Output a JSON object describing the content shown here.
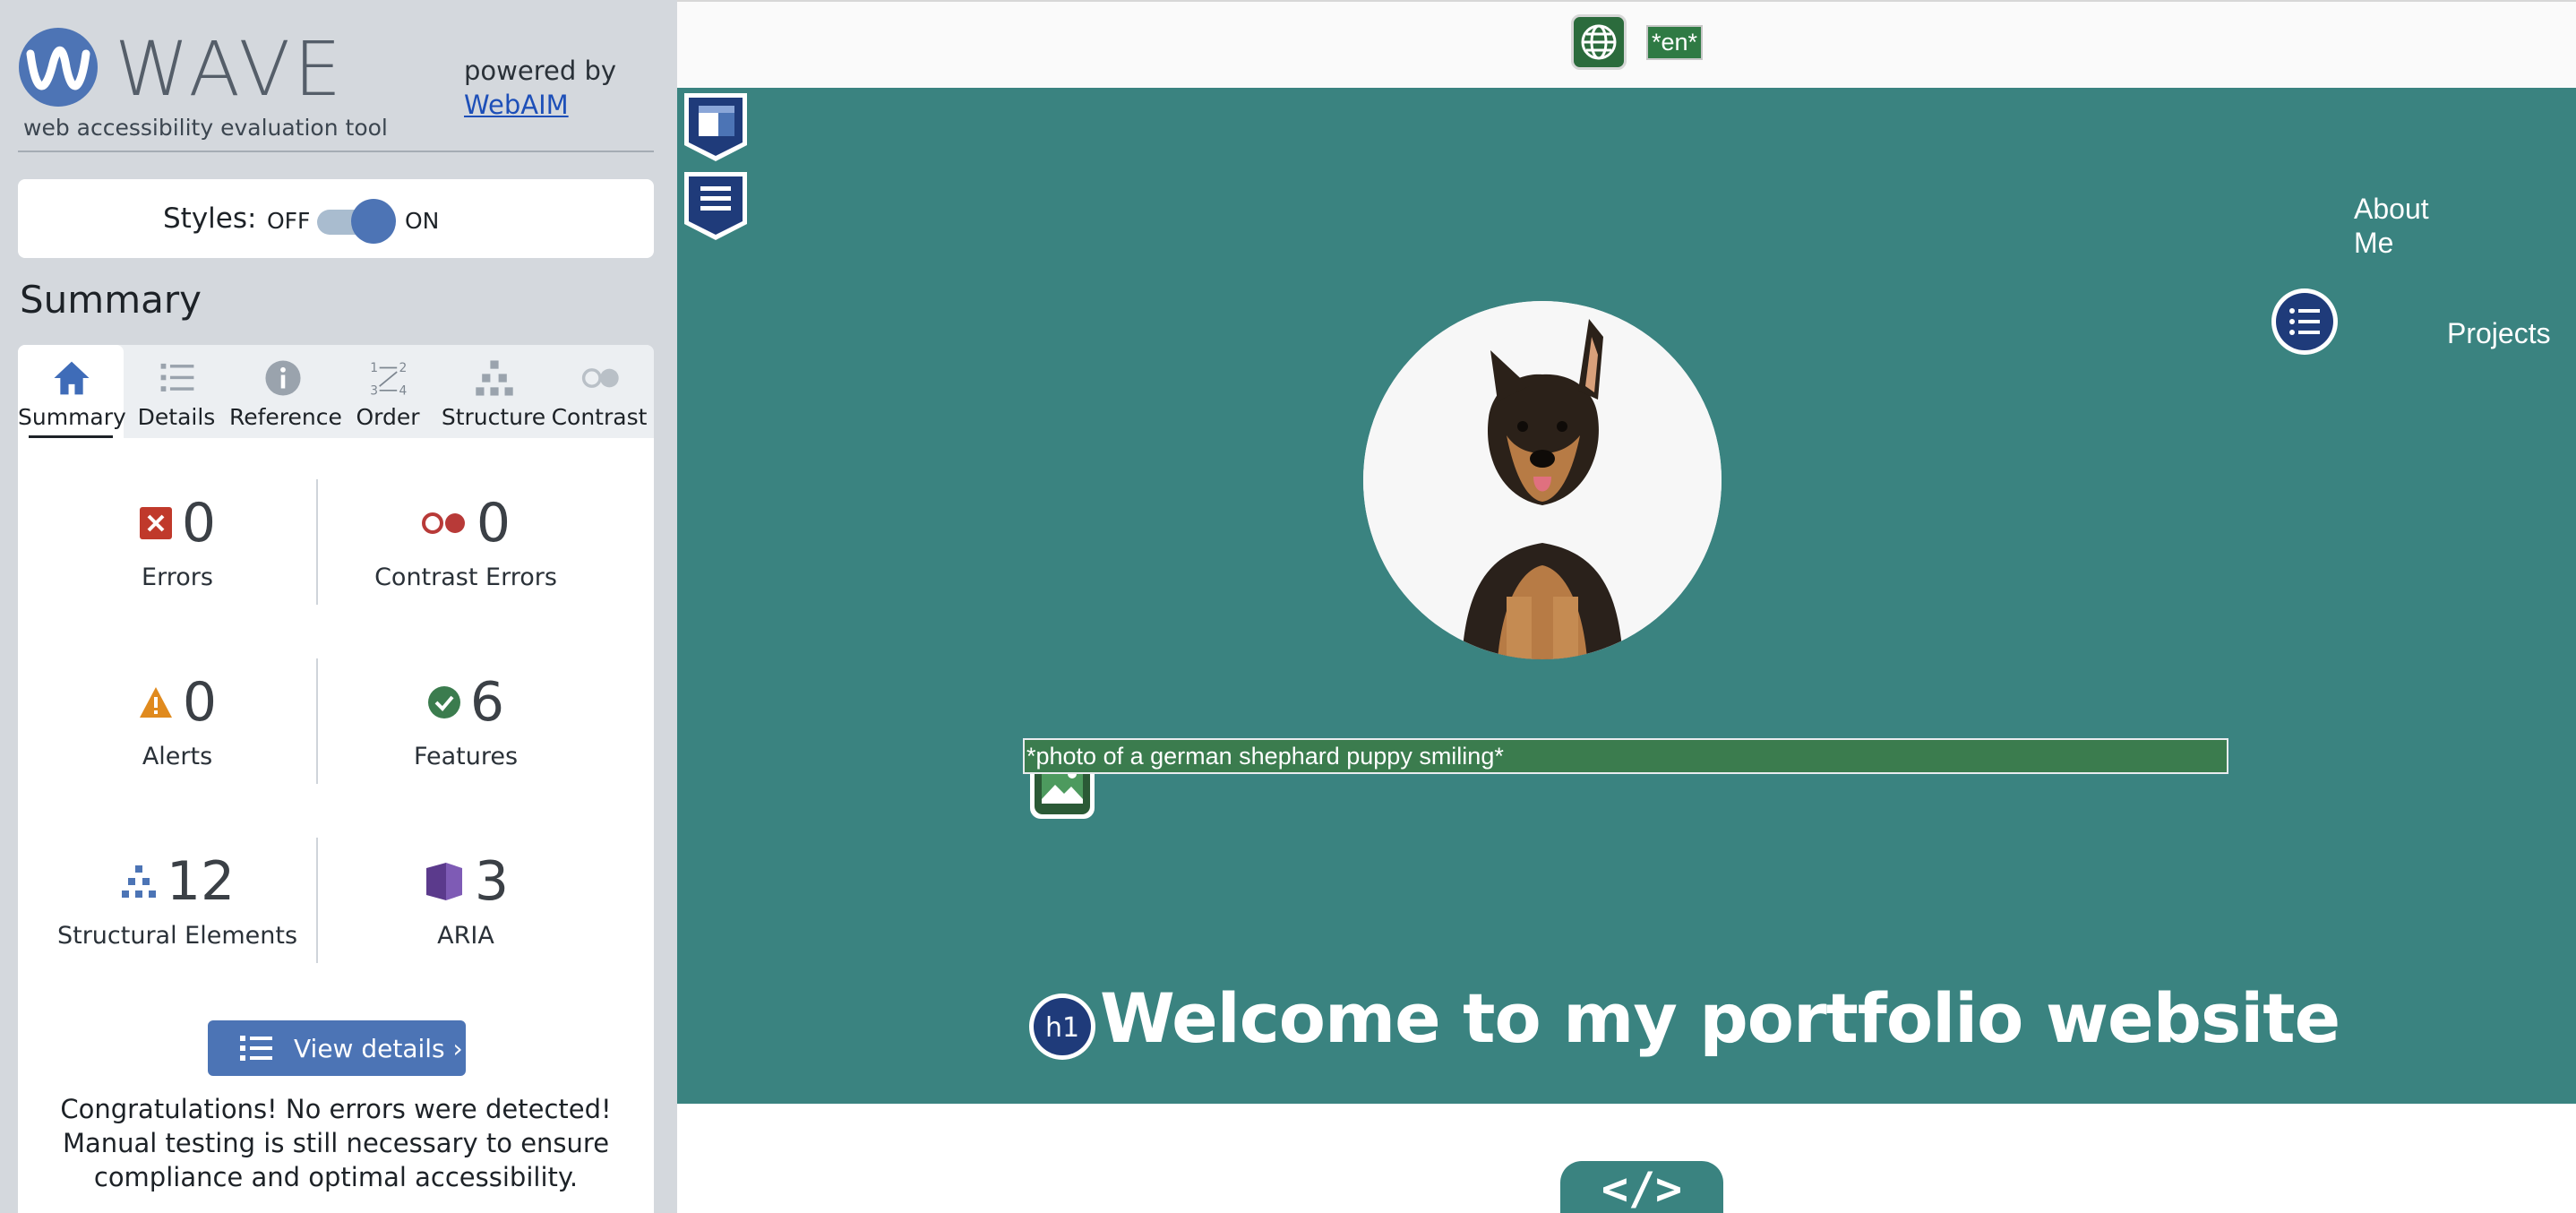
{
  "wave": {
    "logo_text": "WAVE",
    "subtitle": "web accessibility evaluation tool",
    "powered_by": "powered by",
    "webaim_link": "WebAIM"
  },
  "styles": {
    "label": "Styles:",
    "off": "OFF",
    "on": "ON",
    "state": "on"
  },
  "summary_heading": "Summary",
  "tabs": [
    {
      "label": "Summary",
      "icon": "home-icon",
      "active": true
    },
    {
      "label": "Details",
      "icon": "list-icon",
      "active": false
    },
    {
      "label": "Reference",
      "icon": "info-icon",
      "active": false
    },
    {
      "label": "Order",
      "icon": "order-icon",
      "active": false
    },
    {
      "label": "Structure",
      "icon": "structure-icon",
      "active": false
    },
    {
      "label": "Contrast",
      "icon": "contrast-icon",
      "active": false
    }
  ],
  "stats": {
    "errors": {
      "count": "0",
      "label": "Errors"
    },
    "contrast_errors": {
      "count": "0",
      "label": "Contrast Errors"
    },
    "alerts": {
      "count": "0",
      "label": "Alerts"
    },
    "features": {
      "count": "6",
      "label": "Features"
    },
    "structural": {
      "count": "12",
      "label": "Structural Elements"
    },
    "aria": {
      "count": "3",
      "label": "ARIA"
    }
  },
  "view_details": "View details ›",
  "congrats": "Congratulations! No errors were detected! Manual testing is still necessary to ensure compliance and optimal accessibility.",
  "preview": {
    "lang_tag": "*en*",
    "nav": {
      "about": "About Me",
      "projects": "Projects"
    },
    "image_alt": "*photo of a german shephard puppy smiling*",
    "h1_badge": "h1",
    "heading": "Welcome to my portfolio website",
    "code_badge": "</>"
  },
  "colors": {
    "sidebar_bg": "#d4d8dd",
    "accent_blue": "#4c74b5",
    "teal": "#3a8380",
    "alt_green": "#3b7c4e",
    "error_red": "#c0392b",
    "alert_orange": "#e08a1e",
    "feature_green": "#3b7c4e",
    "aria_purple": "#5b3a8c"
  }
}
